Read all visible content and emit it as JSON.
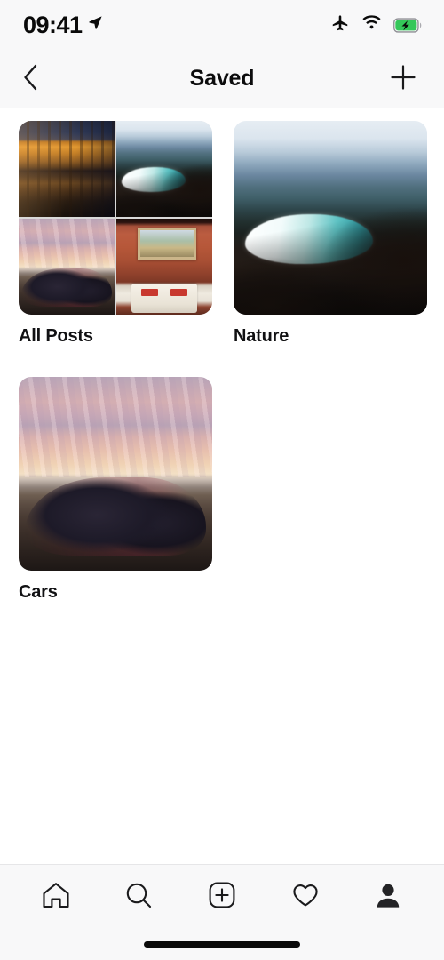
{
  "status_bar": {
    "time": "09:41",
    "location_icon": "location-arrow-icon",
    "airplane_icon": "airplane-mode-icon",
    "wifi_icon": "wifi-icon",
    "battery_icon": "battery-charging-icon",
    "battery_color": "#34c759"
  },
  "header": {
    "back_icon": "chevron-left-icon",
    "title": "Saved",
    "add_icon": "plus-icon"
  },
  "collections": [
    {
      "label": "All Posts",
      "layout": "quad",
      "tiles": [
        "photo-building-reflection",
        "photo-crater-lake",
        "photo-car-beach-sunset",
        "photo-diner-interior"
      ]
    },
    {
      "label": "Nature",
      "layout": "single",
      "tiles": [
        "photo-crater-lake"
      ]
    },
    {
      "label": "Cars",
      "layout": "single",
      "tiles": [
        "photo-car-beach-sunset"
      ]
    }
  ],
  "tabbar": {
    "items": [
      {
        "name": "home-icon",
        "label": "Home",
        "active": false
      },
      {
        "name": "search-icon",
        "label": "Search",
        "active": false
      },
      {
        "name": "add-post-icon",
        "label": "Create",
        "active": false
      },
      {
        "name": "heart-icon",
        "label": "Activity",
        "active": false
      },
      {
        "name": "profile-icon",
        "label": "Profile",
        "active": true
      }
    ]
  },
  "home_indicator": "home-indicator"
}
